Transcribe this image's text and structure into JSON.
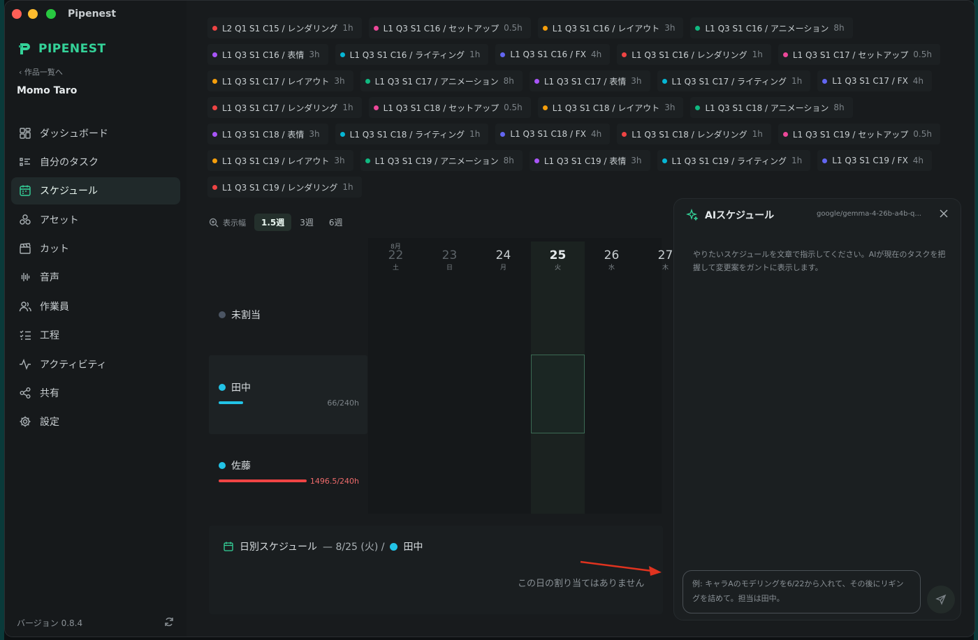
{
  "app": {
    "title": "Pipenest"
  },
  "sidebar": {
    "logo_text": "PIPENEST",
    "back_label": "作品一覧へ",
    "project_name": "Momo Taro",
    "items": [
      {
        "label": "ダッシュボード",
        "icon": "dashboard-icon"
      },
      {
        "label": "自分のタスク",
        "icon": "task-list-icon"
      },
      {
        "label": "スケジュール",
        "icon": "calendar-icon"
      },
      {
        "label": "アセット",
        "icon": "asset-icon"
      },
      {
        "label": "カット",
        "icon": "clapper-icon"
      },
      {
        "label": "音声",
        "icon": "audio-wave-icon"
      },
      {
        "label": "作業員",
        "icon": "users-icon"
      },
      {
        "label": "工程",
        "icon": "checklist-icon"
      },
      {
        "label": "アクティビティ",
        "icon": "activity-icon"
      },
      {
        "label": "共有",
        "icon": "share-icon"
      },
      {
        "label": "設定",
        "icon": "gear-icon"
      }
    ],
    "active_index": 2,
    "version": "バージョン 0.8.4"
  },
  "tasks": [
    [
      {
        "label": "L2 Q1 S1 C15 / レンダリング",
        "hours": "1h",
        "color": "#ef4444"
      },
      {
        "label": "L1 Q3 S1 C16 / セットアップ",
        "hours": "0.5h",
        "color": "#ec4899"
      },
      {
        "label": "L1 Q3 S1 C16 / レイアウト",
        "hours": "3h",
        "color": "#f59e0b"
      },
      {
        "label": "L1 Q3 S1 C16 / アニメーション",
        "hours": "8h",
        "color": "#10b981"
      }
    ],
    [
      {
        "label": "L1 Q3 S1 C16 / 表情",
        "hours": "3h",
        "color": "#a855f7"
      },
      {
        "label": "L1 Q3 S1 C16 / ライティング",
        "hours": "1h",
        "color": "#06b6d4"
      },
      {
        "label": "L1 Q3 S1 C16 / FX",
        "hours": "4h",
        "color": "#6366f1"
      },
      {
        "label": "L1 Q3 S1 C16 / レンダリング",
        "hours": "1h",
        "color": "#ef4444"
      },
      {
        "label": "L1 Q3 S1 C17 / セットアップ",
        "hours": "0.5h",
        "color": "#ec4899"
      }
    ],
    [
      {
        "label": "L1 Q3 S1 C17 / レイアウト",
        "hours": "3h",
        "color": "#f59e0b"
      },
      {
        "label": "L1 Q3 S1 C17 / アニメーション",
        "hours": "8h",
        "color": "#10b981"
      },
      {
        "label": "L1 Q3 S1 C17 / 表情",
        "hours": "3h",
        "color": "#a855f7"
      },
      {
        "label": "L1 Q3 S1 C17 / ライティング",
        "hours": "1h",
        "color": "#06b6d4"
      },
      {
        "label": "L1 Q3 S1 C17 / FX",
        "hours": "4h",
        "color": "#6366f1"
      }
    ],
    [
      {
        "label": "L1 Q3 S1 C17 / レンダリング",
        "hours": "1h",
        "color": "#ef4444"
      },
      {
        "label": "L1 Q3 S1 C18 / セットアップ",
        "hours": "0.5h",
        "color": "#ec4899"
      },
      {
        "label": "L1 Q3 S1 C18 / レイアウト",
        "hours": "3h",
        "color": "#f59e0b"
      },
      {
        "label": "L1 Q3 S1 C18 / アニメーション",
        "hours": "8h",
        "color": "#10b981"
      }
    ],
    [
      {
        "label": "L1 Q3 S1 C18 / 表情",
        "hours": "3h",
        "color": "#a855f7"
      },
      {
        "label": "L1 Q3 S1 C18 / ライティング",
        "hours": "1h",
        "color": "#06b6d4"
      },
      {
        "label": "L1 Q3 S1 C18 / FX",
        "hours": "4h",
        "color": "#6366f1"
      },
      {
        "label": "L1 Q3 S1 C18 / レンダリング",
        "hours": "1h",
        "color": "#ef4444"
      },
      {
        "label": "L1 Q3 S1 C19 / セットアップ",
        "hours": "0.5h",
        "color": "#ec4899"
      }
    ],
    [
      {
        "label": "L1 Q3 S1 C19 / レイアウト",
        "hours": "3h",
        "color": "#f59e0b"
      },
      {
        "label": "L1 Q3 S1 C19 / アニメーション",
        "hours": "8h",
        "color": "#10b981"
      },
      {
        "label": "L1 Q3 S1 C19 / 表情",
        "hours": "3h",
        "color": "#a855f7"
      },
      {
        "label": "L1 Q3 S1 C19 / ライティング",
        "hours": "1h",
        "color": "#06b6d4"
      },
      {
        "label": "L1 Q3 S1 C19 / FX",
        "hours": "4h",
        "color": "#6366f1"
      }
    ],
    [
      {
        "label": "L1 Q3 S1 C19 / レンダリング",
        "hours": "1h",
        "color": "#ef4444"
      }
    ]
  ],
  "zoom": {
    "label": "表示幅",
    "options": [
      "1.5週",
      "3週",
      "6週"
    ],
    "active": "1.5週"
  },
  "dates": [
    {
      "month": "8月",
      "day": "22",
      "weekday": "土",
      "state": "dim"
    },
    {
      "month": "",
      "day": "23",
      "weekday": "日",
      "state": "dim"
    },
    {
      "month": "",
      "day": "24",
      "weekday": "月",
      "state": ""
    },
    {
      "month": "",
      "day": "25",
      "weekday": "火",
      "state": "today"
    },
    {
      "month": "",
      "day": "26",
      "weekday": "水",
      "state": ""
    },
    {
      "month": "",
      "day": "27",
      "weekday": "木",
      "state": ""
    }
  ],
  "rows": {
    "unassigned": {
      "name": "未割当",
      "color": "#4b5563"
    },
    "tanaka": {
      "name": "田中",
      "color": "#22c3e6",
      "hours": "66/240h",
      "fill": 0.275,
      "bar_color": "#22c3e6"
    },
    "sato": {
      "name": "佐藤",
      "color": "#22c3e6",
      "hours": "1496.5/240h",
      "fill": 1.0,
      "bar_color": "#ef4444"
    }
  },
  "day_schedule": {
    "title": "日別スケジュール",
    "date": "— 8/25 (火) /",
    "person": "田中",
    "empty": "この日の割り当てはありません"
  },
  "ai": {
    "title": "AIスケジュール",
    "model": "google/gemma-4-26b-a4b-q...",
    "description": "やりたいスケジュールを文章で指示してください。AIが現在のタスクを把握して変更案をガントに表示します。",
    "placeholder": "例: キャラAのモデリングを6/22から入れて、その後にリギングを詰めて。担当は田中。"
  }
}
